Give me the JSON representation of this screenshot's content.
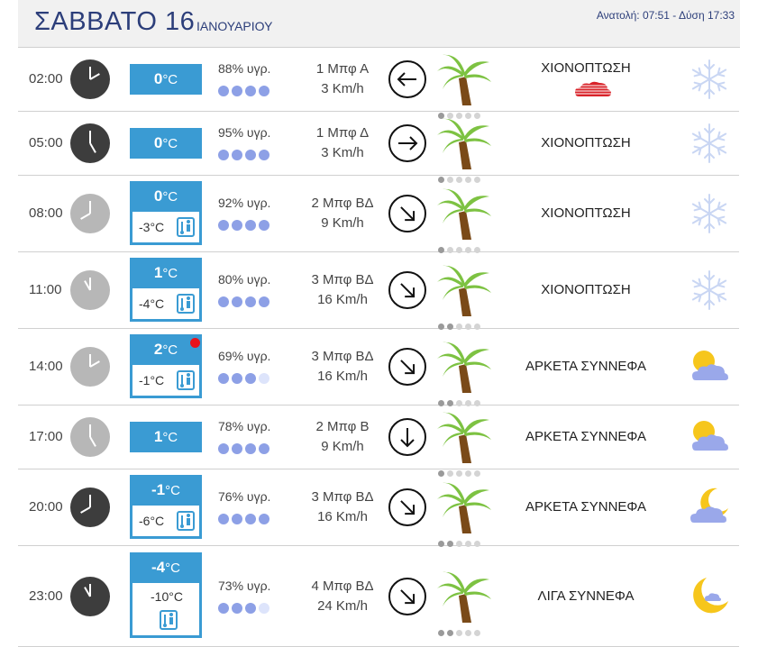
{
  "header": {
    "day": "ΣΑΒΒΑΤΟ 16",
    "month": "ΙΑΝΟΥΑΡΙΟΥ",
    "sunrise_sunset": "Ανατολή: 07:51  - Δύση 17:33"
  },
  "colors": {
    "accent": "#3a9bd3",
    "title": "#2c3e7a",
    "dot_on": "#8da0e6",
    "dot_off": "#dde4fb",
    "alert": "#e8121b"
  },
  "rows": [
    {
      "time": "02:00",
      "temp": "0",
      "unit": "°C",
      "feel": "",
      "humidity": "88% υγρ.",
      "humidity_level": 4,
      "beaufort": "1 Μπφ Α",
      "speed": "3 Km/h",
      "wind_dir": "west-arrow-icon",
      "wind_level": 1,
      "desc": "ΧΙΟΝΟΠΤΩΣΗ",
      "icon": "snowflake-icon",
      "night": true
    },
    {
      "time": "05:00",
      "temp": "0",
      "unit": "°C",
      "feel": "",
      "humidity": "95% υγρ.",
      "humidity_level": 4,
      "beaufort": "1 Μπφ Δ",
      "speed": "3 Km/h",
      "wind_dir": "east-arrow-icon",
      "wind_level": 1,
      "desc": "ΧΙΟΝΟΠΤΩΣΗ",
      "icon": "snowflake-icon",
      "night": true
    },
    {
      "time": "08:00",
      "temp": "0",
      "unit": "°C",
      "feel": "-3°C",
      "humidity": "92% υγρ.",
      "humidity_level": 4,
      "beaufort": "2 Μπφ ΒΔ",
      "speed": "9 Km/h",
      "wind_dir": "southeast-arrow-icon",
      "wind_level": 1,
      "desc": "ΧΙΟΝΟΠΤΩΣΗ",
      "icon": "snowflake-icon",
      "night": false
    },
    {
      "time": "11:00",
      "temp": "1",
      "unit": "°C",
      "feel": "-4°C",
      "humidity": "80% υγρ.",
      "humidity_level": 4,
      "beaufort": "3 Μπφ ΒΔ",
      "speed": "16 Km/h",
      "wind_dir": "southeast-arrow-icon",
      "wind_level": 2,
      "desc": "ΧΙΟΝΟΠΤΩΣΗ",
      "icon": "snowflake-icon",
      "night": false
    },
    {
      "time": "14:00",
      "temp": "2",
      "unit": "°C",
      "feel": "-1°C",
      "humidity": "69% υγρ.",
      "humidity_level": 3,
      "beaufort": "3 Μπφ ΒΔ",
      "speed": "16 Km/h",
      "wind_dir": "southeast-arrow-icon",
      "wind_level": 2,
      "desc": "ΑΡΚΕΤΑ ΣΥΝΝΕΦΑ",
      "icon": "sun-cloud-icon",
      "night": false
    },
    {
      "time": "17:00",
      "temp": "1",
      "unit": "°C",
      "feel": "",
      "humidity": "78% υγρ.",
      "humidity_level": 4,
      "beaufort": "2 Μπφ Β",
      "speed": "9 Km/h",
      "wind_dir": "south-arrow-icon",
      "wind_level": 1,
      "desc": "ΑΡΚΕΤΑ ΣΥΝΝΕΦΑ",
      "icon": "sun-cloud-icon",
      "night": false
    },
    {
      "time": "20:00",
      "temp": "-1",
      "unit": "°C",
      "feel": "-6°C",
      "humidity": "76% υγρ.",
      "humidity_level": 4,
      "beaufort": "3 Μπφ ΒΔ",
      "speed": "16 Km/h",
      "wind_dir": "southeast-arrow-icon",
      "wind_level": 2,
      "desc": "ΑΡΚΕΤΑ ΣΥΝΝΕΦΑ",
      "icon": "moon-cloud-icon",
      "night": true
    },
    {
      "time": "23:00",
      "temp": "-4",
      "unit": "°C",
      "feel": "-10°C",
      "humidity": "73% υγρ.",
      "humidity_level": 3,
      "beaufort": "4 Μπφ ΒΔ",
      "speed": "24 Km/h",
      "wind_dir": "southeast-arrow-icon",
      "wind_level": 2,
      "desc": "ΛΙΓΑ ΣΥΝΝΕΦΑ",
      "icon": "moon-small-cloud-icon",
      "night": true
    }
  ]
}
